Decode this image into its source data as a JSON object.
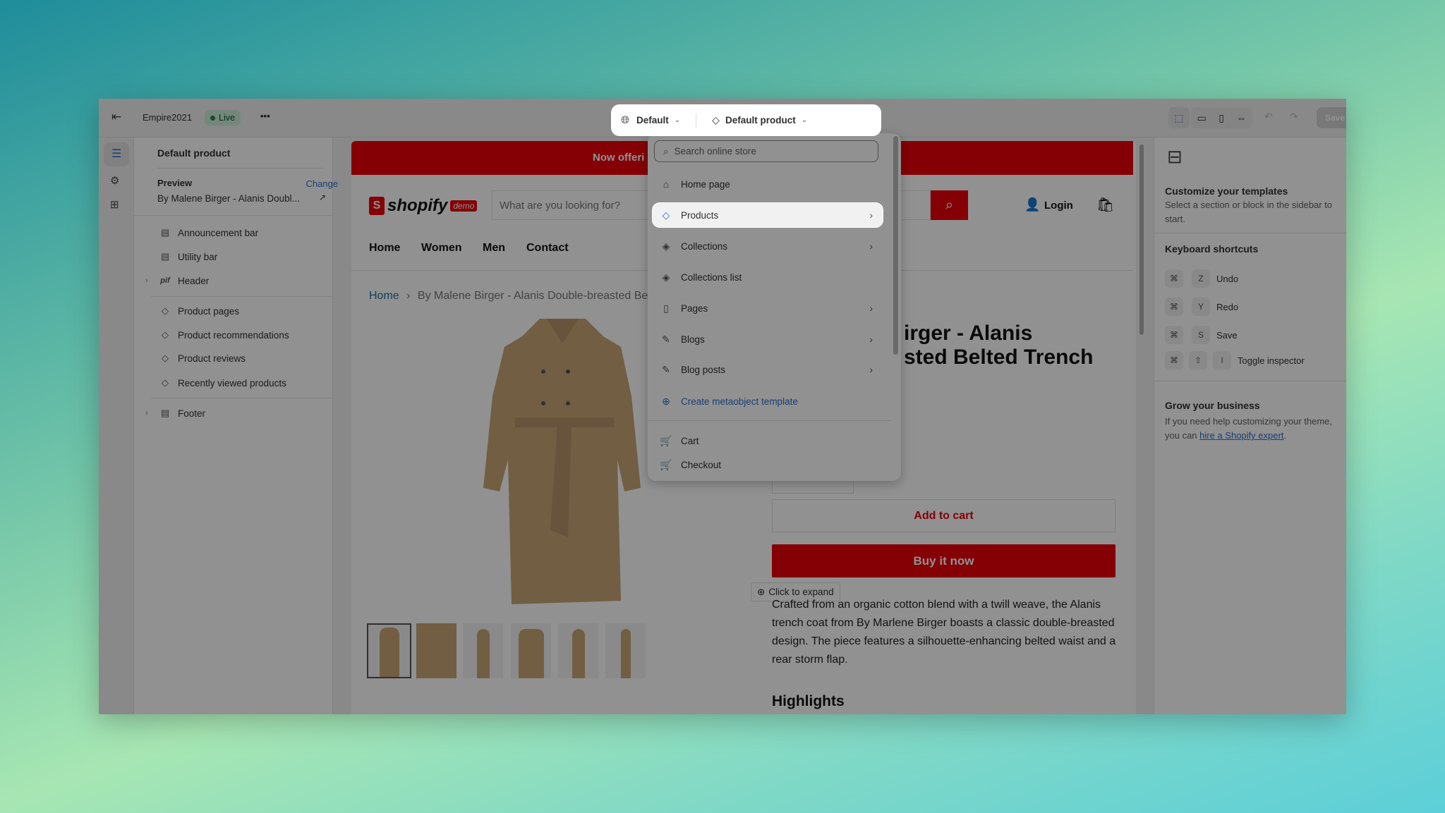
{
  "topbar": {
    "store_name": "Empire2021",
    "status": "Live",
    "more": "•••",
    "theme_select": "Default",
    "template_select": "Default product",
    "save_label": "Save",
    "icons": [
      "exit-icon",
      "inspector-icon",
      "desktop-icon",
      "mobile-icon",
      "fullwidth-icon",
      "undo-icon",
      "redo-icon"
    ]
  },
  "sidebar": {
    "title": "Default product",
    "preview_label": "Preview",
    "change_label": "Change",
    "preview_value": "By Malene Birger - Alanis Doubl...",
    "items": [
      {
        "label": "Announcement bar",
        "icon": "section-icon"
      },
      {
        "label": "Utility bar",
        "icon": "section-icon"
      },
      {
        "label": "Header",
        "icon": "header-logo-icon"
      },
      {
        "label": "Product pages",
        "icon": "tag-icon"
      },
      {
        "label": "Product recommendations",
        "icon": "tag-icon"
      },
      {
        "label": "Product reviews",
        "icon": "tag-icon"
      },
      {
        "label": "Recently viewed products",
        "icon": "tag-icon"
      },
      {
        "label": "Footer",
        "icon": "section-icon"
      }
    ]
  },
  "dropdown": {
    "search_placeholder": "Search online store",
    "items": [
      {
        "label": "Home page"
      },
      {
        "label": "Products"
      },
      {
        "label": "Collections"
      },
      {
        "label": "Collections list"
      },
      {
        "label": "Pages"
      },
      {
        "label": "Blogs"
      },
      {
        "label": "Blog posts"
      },
      {
        "label": "Create metaobject template"
      },
      {
        "label": "Cart"
      },
      {
        "label": "Checkout"
      }
    ]
  },
  "store": {
    "announcement": "Now offeri",
    "logo_text": "shopify",
    "logo_badge": "demo",
    "search_placeholder": "What are you looking for?",
    "login": "Login",
    "nav": [
      "Home",
      "Women",
      "Men",
      "Contact"
    ],
    "breadcrumb_home": "Home",
    "breadcrumb_sep": "›",
    "breadcrumb_current": "By Malene Birger - Alanis Double-breasted Be",
    "title_line1": "irger - Alanis",
    "title_line2": "sted Belted Trench",
    "add_to_cart": "Add to cart",
    "buy_now": "Buy it now",
    "expand": "Click to expand",
    "description": "Crafted from an organic cotton blend with a twill weave, the Alanis trench coat from By Marlene Birger boasts a classic double-breasted design. The piece features a silhouette-enhancing belted waist and a rear storm flap.",
    "highlights": "Highlights",
    "brand_color": "#e8000a"
  },
  "right_panel": {
    "customize_title": "Customize your templates",
    "customize_text": "Select a section or block in the sidebar to start.",
    "shortcuts_title": "Keyboard shortcuts",
    "shortcuts": [
      {
        "keys": [
          "⌘",
          "Z"
        ],
        "label": "Undo"
      },
      {
        "keys": [
          "⌘",
          "Y"
        ],
        "label": "Redo"
      },
      {
        "keys": [
          "⌘",
          "S"
        ],
        "label": "Save"
      },
      {
        "keys": [
          "⌘",
          "⇧",
          "I"
        ],
        "label": "Toggle inspector"
      }
    ],
    "grow_title": "Grow your business",
    "grow_text": "If you need help customizing your theme, you can ",
    "grow_link": "hire a Shopify expert",
    "grow_end": "."
  }
}
